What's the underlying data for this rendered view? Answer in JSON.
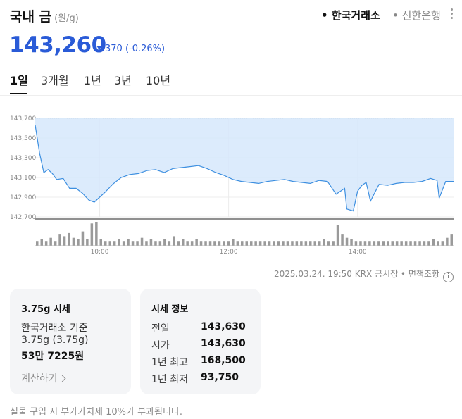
{
  "header": {
    "title": "국내 금",
    "unit": "(원/g)",
    "sources": [
      "한국거래소",
      "신한은행"
    ],
    "active_source_index": 0
  },
  "price": {
    "current": "143,260",
    "change": "370",
    "change_percent": "(-0.26%)",
    "direction": "down"
  },
  "tabs": [
    "1일",
    "3개월",
    "1년",
    "3년",
    "10년"
  ],
  "active_tab_index": 0,
  "chart_data": {
    "type": "area",
    "title": "",
    "xlabel": "",
    "ylabel": "",
    "ylim": [
      142700,
      143700
    ],
    "y_ticks": [
      "143,700",
      "143,500",
      "143,300",
      "143,100",
      "142,900",
      "142,700"
    ],
    "x_ticks": [
      "10:00",
      "12:00",
      "14:00"
    ],
    "x_range": [
      "09:00",
      "15:30"
    ],
    "grid": true,
    "line_color": "#3d8fe0",
    "fill_color": "#d6e8fb",
    "series": [
      {
        "x": [
          "09:00",
          "09:04",
          "09:08",
          "09:12",
          "09:16",
          "09:20",
          "09:26",
          "09:32",
          "09:38",
          "09:44",
          "09:50",
          "09:55",
          "10:00",
          "10:05",
          "10:12",
          "10:20",
          "10:28",
          "10:36",
          "10:44",
          "10:52",
          "11:00",
          "11:08",
          "11:16",
          "11:24",
          "11:32",
          "11:40",
          "11:48",
          "11:56",
          "12:04",
          "12:12",
          "12:20",
          "12:28",
          "12:36",
          "12:44",
          "12:52",
          "13:00",
          "13:08",
          "13:16",
          "13:24",
          "13:32",
          "13:40",
          "13:48",
          "13:50",
          "13:56",
          "14:00",
          "14:04",
          "14:08",
          "14:12",
          "14:20",
          "14:28",
          "14:36",
          "14:44",
          "14:52",
          "15:00",
          "15:08",
          "15:14",
          "15:16",
          "15:22",
          "15:30"
        ],
        "values": [
          143630,
          143350,
          143150,
          143180,
          143140,
          143080,
          143090,
          142990,
          142990,
          142940,
          142870,
          142850,
          142900,
          142950,
          143030,
          143100,
          143130,
          143140,
          143170,
          143180,
          143150,
          143190,
          143200,
          143210,
          143220,
          143190,
          143150,
          143120,
          143080,
          143060,
          143050,
          143040,
          143060,
          143070,
          143080,
          143060,
          143050,
          143040,
          143070,
          143060,
          142930,
          142990,
          142780,
          142760,
          142960,
          143020,
          143050,
          142860,
          143030,
          143020,
          143040,
          143050,
          143050,
          143060,
          143090,
          143070,
          142890,
          143060,
          143060
        ]
      }
    ],
    "volume": [
      3,
      4,
      3,
      5,
      3,
      7,
      6,
      8,
      5,
      4,
      9,
      4,
      14,
      15,
      4,
      3,
      3,
      3,
      4,
      3,
      4,
      3,
      3,
      5,
      3,
      4,
      3,
      3,
      4,
      3,
      6,
      3,
      4,
      3,
      3,
      4,
      3,
      3,
      3,
      3,
      3,
      3,
      3,
      4,
      3,
      3,
      3,
      3,
      3,
      3,
      3,
      3,
      3,
      3,
      3,
      3,
      3,
      3,
      3,
      3,
      3,
      3,
      3,
      4,
      3,
      3,
      13,
      7,
      5,
      4,
      3,
      3,
      3,
      3,
      3,
      3,
      3,
      3,
      3,
      3,
      3,
      3,
      3,
      3,
      3,
      3,
      3,
      4,
      3,
      3,
      5,
      7
    ]
  },
  "meta": {
    "timestamp": "2025.03.24. 19:50 KRX 금시장",
    "disclaimer": "면책조항"
  },
  "card_market": {
    "title": "3.75g 시세",
    "line1": "한국거래소 기준",
    "line2": "3.75g (3.75g)",
    "line3": "53만 7225원",
    "calc_label": "계산하기"
  },
  "card_info": {
    "title": "시세 정보",
    "rows": [
      {
        "label": "전일",
        "value": "143,630"
      },
      {
        "label": "시가",
        "value": "143,630"
      },
      {
        "label": "1년 최고",
        "value": "168,500"
      },
      {
        "label": "1년 최저",
        "value": "93,750"
      }
    ]
  },
  "footnote": "실물 구입 시 부가가치세 10%가 부과됩니다."
}
